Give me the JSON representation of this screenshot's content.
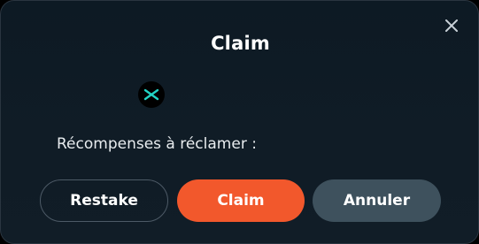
{
  "dialog": {
    "title": "Claim",
    "close_icon": "close-icon",
    "token_icon": "cross-chain-token-icon",
    "rewards_label": "Récompenses à réclamer :",
    "rewards_value": "",
    "buttons": {
      "restake": "Restake",
      "claim": "Claim",
      "cancel": "Annuler"
    },
    "colors": {
      "background": "#0f1b25",
      "claim_button": "#f2582c",
      "cancel_button": "#3e515d",
      "restake_border": "#4d5a66",
      "token_accent": "#22d3c5"
    }
  }
}
